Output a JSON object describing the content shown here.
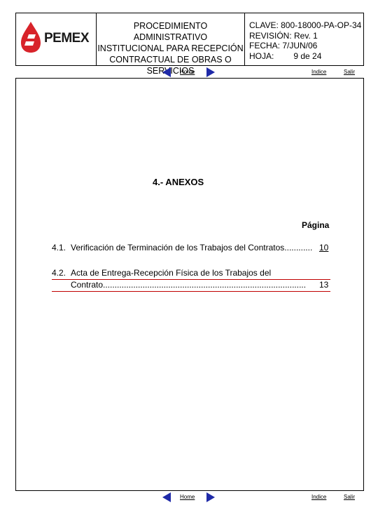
{
  "header": {
    "logo_text": "PEMEX",
    "title_lines": [
      "PROCEDIMIENTO ADMINISTRATIVO",
      "INSTITUCIONAL PARA RECEPCIÓN",
      "CONTRACTUAL DE OBRAS O",
      "SERVICIOS"
    ],
    "clave": "CLAVE: 800-18000-PA-OP-34",
    "revision": "REVISIÓN: Rev. 1",
    "fecha": "FECHA: 7/JUN/06",
    "hoja_label": "HOJA:",
    "hoja_value": "9 de 24"
  },
  "nav": {
    "home": "Home",
    "indice": "Indice",
    "salir": "Salir"
  },
  "content": {
    "section_title": "4.- ANEXOS",
    "pagina_header": "Página",
    "toc": [
      {
        "num": "4.1.",
        "text": "Verificación de Terminación de los Trabajos del Contratos............",
        "page": "10"
      },
      {
        "num": "4.2.",
        "text_line1": "Acta de Entrega-Recepción Física de los Trabajos del",
        "text_line2": "Contrato.......................................................................................",
        "page": "13"
      }
    ]
  },
  "colors": {
    "logo_red": "#d8232a",
    "arrow_blue": "#1f2aa8",
    "link_underline_red": "#c00000"
  }
}
